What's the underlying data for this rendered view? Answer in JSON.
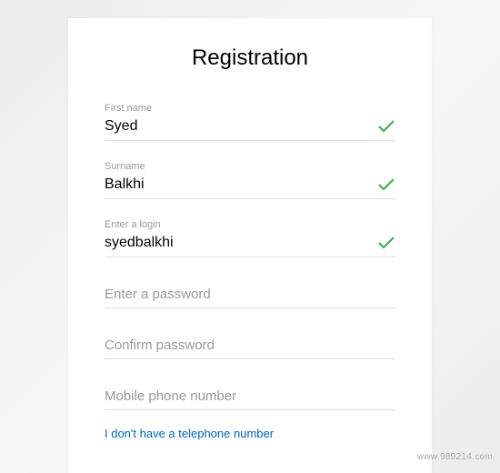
{
  "title": "Registration",
  "fields": {
    "first_name": {
      "label": "First name",
      "value": "Syed",
      "valid": true
    },
    "surname": {
      "label": "Surname",
      "value": "Balkhi",
      "valid": true
    },
    "login": {
      "label": "Enter a login",
      "value": "syedbalkhi",
      "valid": true
    },
    "password": {
      "placeholder": "Enter a password",
      "value": ""
    },
    "confirm": {
      "placeholder": "Confirm password",
      "value": ""
    },
    "phone": {
      "placeholder": "Mobile phone number",
      "value": ""
    }
  },
  "no_phone_link": "I don't have a telephone number",
  "watermark": "www.989214.com"
}
